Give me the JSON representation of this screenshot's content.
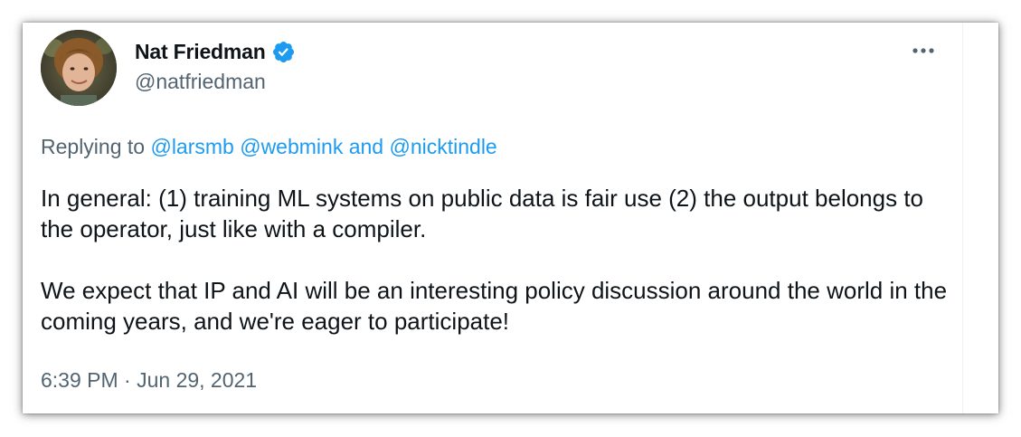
{
  "author": {
    "display_name": "Nat Friedman",
    "handle": "@natfriedman",
    "verified": true,
    "avatar_icon": "profile-photo"
  },
  "reply": {
    "prefix": "Replying to",
    "mention_1": "@larsmb",
    "mention_2": "@webmink",
    "conjunction": "and",
    "mention_3": "@nicktindle"
  },
  "tweet": {
    "paragraph_1": "In general: (1) training ML systems on public data is fair use (2) the output belongs to the operator, just like with a compiler.",
    "paragraph_2": "We expect that IP and AI will be an interesting policy discussion around the world in the coming years, and we're eager to participate!",
    "timestamp": "6:39 PM · Jun 29, 2021"
  },
  "icons": {
    "verified": "verified-badge-icon",
    "more": "more-options-icon"
  },
  "colors": {
    "accent": "#1d9bf0",
    "text_primary": "#0f1419",
    "text_secondary": "#536471"
  }
}
